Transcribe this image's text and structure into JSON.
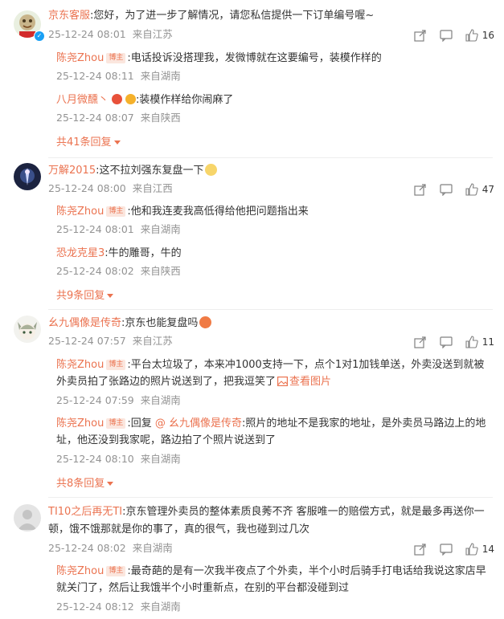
{
  "colors": {
    "accent": "#eb7350",
    "meta": "#939393",
    "text": "#333333"
  },
  "comments": [
    {
      "name": "京东客服",
      "text": ":您好，为了进一步了解情况，请您私信提供一下订单编号喔~",
      "time": "25-12-24 08:01",
      "location": "来自江苏",
      "likes": "16",
      "replies": [
        {
          "name": "陈尧Zhou",
          "badge": "博主",
          "text": ":电话投诉没搭理我，发微博就在这要编号，装模作样的",
          "time": "25-12-24 08:11",
          "location": "来自湖南"
        },
        {
          "name": "八月微醺丶",
          "text": ":装模作样给你闹麻了",
          "time": "25-12-24 08:07",
          "location": "来自陕西"
        }
      ],
      "more": "共41条回复"
    },
    {
      "name": "万解2015",
      "text": ":这不拉刘强东复盘一下",
      "time": "25-12-24 08:00",
      "location": "来自江西",
      "likes": "47",
      "replies": [
        {
          "name": "陈尧Zhou",
          "badge": "博主",
          "text": ":他和我连麦我高低得给他把问题指出来",
          "time": "25-12-24 08:01",
          "location": "来自湖南"
        },
        {
          "name": "恐龙克星3",
          "text": ":牛的雕哥，牛的",
          "time": "25-12-24 08:02",
          "location": "来自陕西"
        }
      ],
      "more": "共9条回复"
    },
    {
      "name": "幺九偶像是传奇",
      "text": ":京东也能复盘吗",
      "time": "25-12-24 07:57",
      "location": "来自江苏",
      "likes": "11",
      "replies": [
        {
          "name": "陈尧Zhou",
          "badge": "博主",
          "text1": ":平台太垃圾了，本来冲1000支持一下，点个1对1加钱单送，外卖没送到就被",
          "text2": "外卖员拍了张路边的照片说送到了，把我逗笑了",
          "viewpic": "查看图片",
          "time": "25-12-24 07:59",
          "location": "来自湖南"
        },
        {
          "name": "陈尧Zhou",
          "badge": "博主",
          "reply_prefix": ":回复",
          "mention": "@ 幺九偶像是传奇",
          "text1": ":照片的地址不是我家的地址，是外卖员马路边上的地",
          "text2": "址，他还没到我家呢，路边拍了个照片说送到了",
          "time": "25-12-24 08:10",
          "location": "来自湖南"
        }
      ],
      "more": "共8条回复"
    },
    {
      "name": "TI10之后再无TI",
      "text1": ":京东管理外卖员的整体素质良莠不齐 客服唯一的赔偿方式，就是最多再送你一",
      "text2": "顿，饿不饿那就是你的事了，真的很气，我也碰到过几次",
      "time": "25-12-24 08:02",
      "location": "来自湖南",
      "likes": "14",
      "replies": [
        {
          "name": "陈尧Zhou",
          "badge": "博主",
          "text1": ":最奇葩的是有一次我半夜点了个外卖，半个小时后骑手打电话给我说这家店早",
          "text2": "就关门了，然后让我饿半个小时重新点，在别的平台都没碰到过",
          "time": "25-12-24 08:12",
          "location": "来自湖南"
        }
      ]
    }
  ]
}
